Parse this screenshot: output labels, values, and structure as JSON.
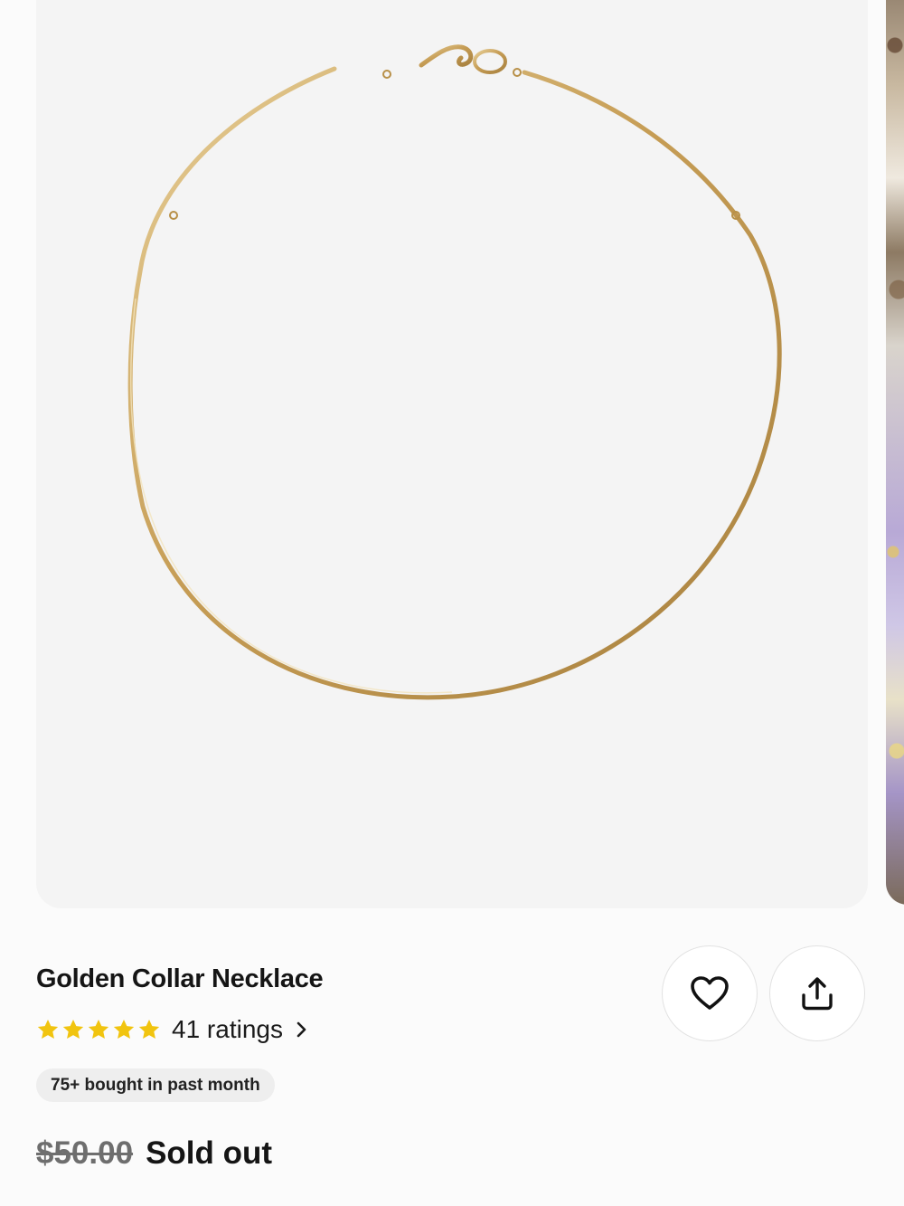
{
  "product": {
    "image_alt": "Gold collar necklace",
    "title": "Golden Collar Necklace",
    "rating": 5,
    "ratings_text": "41 ratings",
    "badge": "75+ bought in past month",
    "original_price": "$50.00",
    "status": "Sold out"
  },
  "actions": {
    "favorite_icon": "heart-icon",
    "share_icon": "share-icon"
  },
  "colors": {
    "star": "#F1C40F",
    "gold": "#c9a25b",
    "image_bg": "#f4f4f4"
  }
}
